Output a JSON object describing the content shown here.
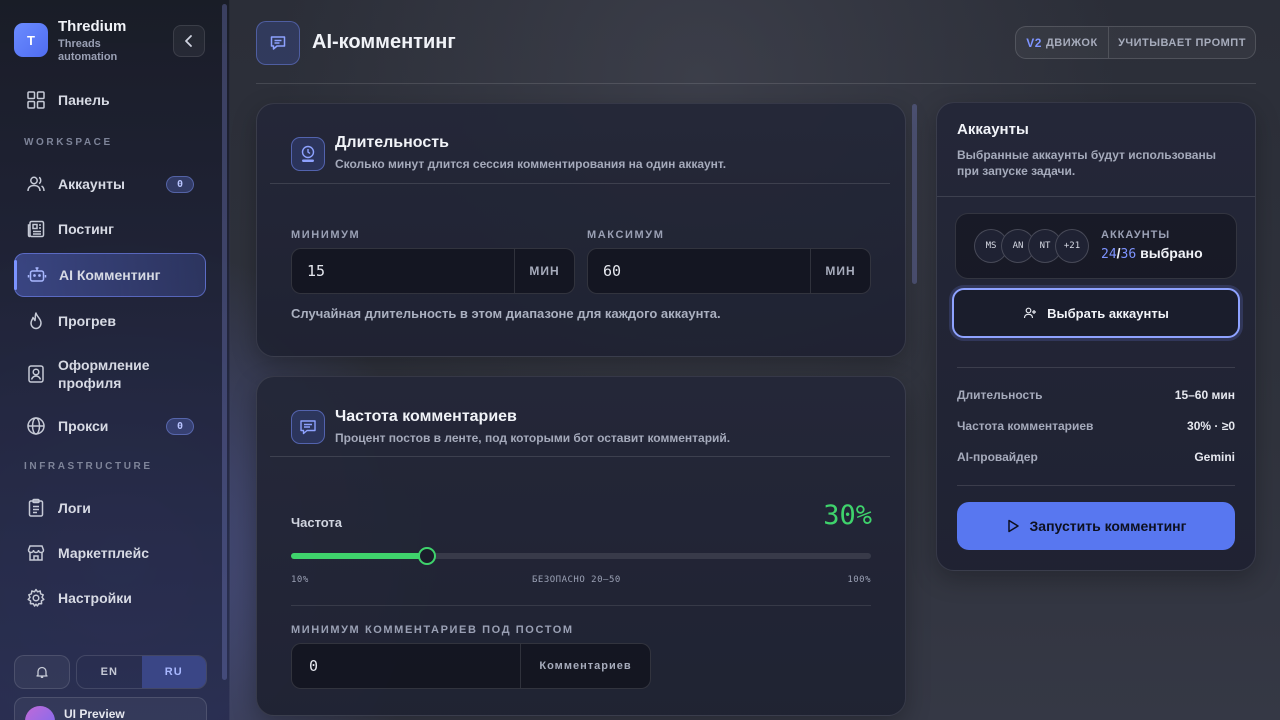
{
  "brand": {
    "initial": "T",
    "name": "Thredium",
    "subtitle": "Threads automation"
  },
  "nav": {
    "dashboard": "Панель",
    "workspace_label": "WORKSPACE",
    "accounts": "Аккаунты",
    "accounts_badge": "0",
    "posting": "Постинг",
    "ai_commenting": "AI Комментинг",
    "warmup": "Прогрев",
    "profile_design": "Оформление профиля",
    "proxies": "Прокси",
    "proxies_badge": "0",
    "infrastructure_label": "INFRASTRUCTURE",
    "logs": "Логи",
    "marketplace": "Маркетплейс",
    "settings": "Настройки"
  },
  "lang": {
    "en": "EN",
    "ru": "RU",
    "selected": "RU"
  },
  "user": {
    "name": "UI Preview"
  },
  "header": {
    "title": "AI-комментинг",
    "engine_version": "V2",
    "engine_label": "ДВИЖОК",
    "prompt_label": "УЧИТЫВАЕТ ПРОМПТ"
  },
  "duration": {
    "title": "Длительность",
    "subtitle": "Сколько минут длится сессия комментирования на один аккаунт.",
    "min_label": "МИНИМУМ",
    "min_value": "15",
    "min_unit": "МИН",
    "max_label": "МАКСИМУМ",
    "max_value": "60",
    "max_unit": "МИН",
    "hint": "Случайная длительность в этом диапазоне для каждого аккаунта."
  },
  "frequency": {
    "title": "Частота комментариев",
    "subtitle": "Процент постов в ленте, под которыми бот оставит комментарий.",
    "label": "Частота",
    "value_text": "30%",
    "value": 30,
    "min": 10,
    "max": 100,
    "tick_min": "10%",
    "tick_mid": "БЕЗОПАСНО 20–50",
    "tick_max": "100%",
    "min_comments_label": "МИНИМУМ КОММЕНТАРИЕВ ПОД ПОСТОМ",
    "min_comments_value": "0",
    "min_comments_unit": "Комментариев"
  },
  "accounts_panel": {
    "title": "Аккаунты",
    "subtitle": "Выбранные аккаунты будут использованы при запуске задачи.",
    "avatars": [
      "MS",
      "AN",
      "NT",
      "+21"
    ],
    "summary_label": "АККАУНТЫ",
    "selected": "24",
    "separator": "/",
    "total": "36",
    "selected_word": "выбрано",
    "select_button": "Выбрать аккаунты",
    "stats": [
      {
        "key": "Длительность",
        "value": "15–60 мин"
      },
      {
        "key": "Частота комментариев",
        "value": "30% · ≥0"
      },
      {
        "key": "AI-провайдер",
        "value": "Gemini"
      }
    ],
    "start_button": "Запустить комментинг"
  },
  "colors": {
    "accent": "#5877f0",
    "success": "#3fd36c",
    "accent_text": "#7e94ff"
  }
}
